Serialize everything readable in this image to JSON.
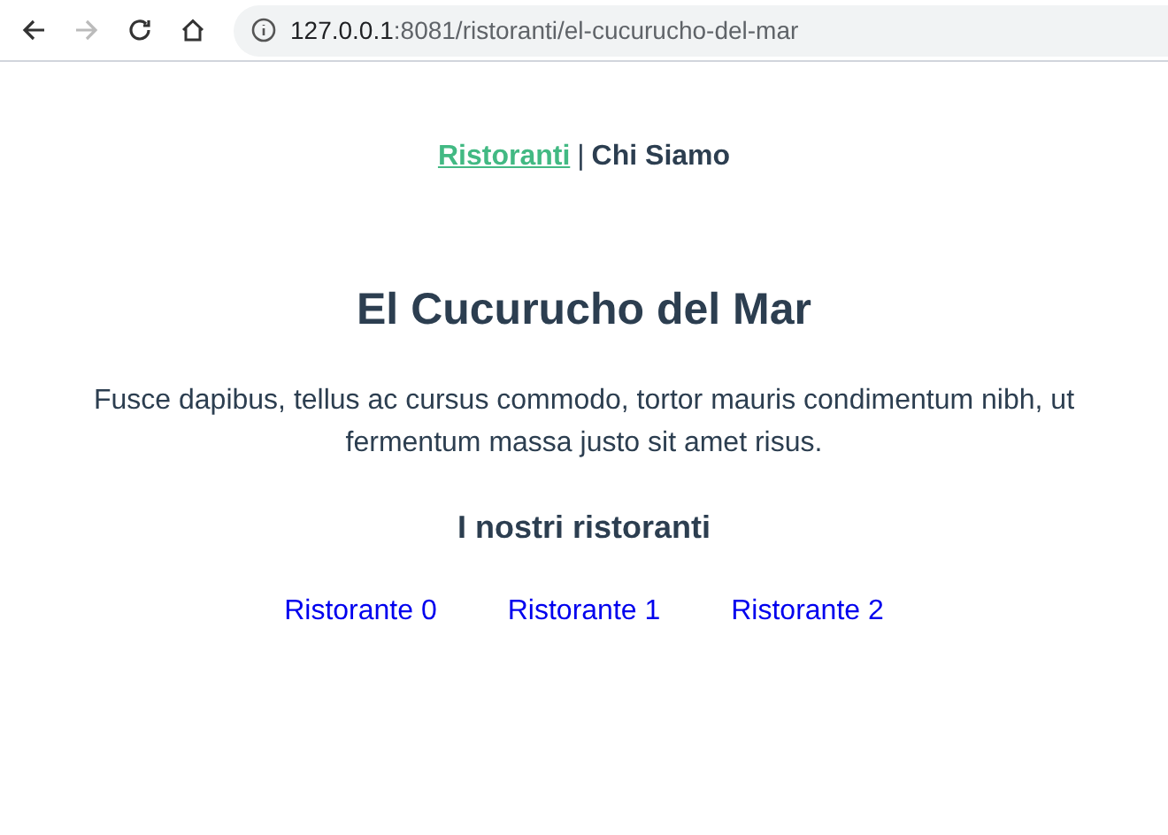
{
  "browser": {
    "back_enabled": true,
    "forward_enabled": false,
    "url_host": "127.0.0.1",
    "url_rest": ":8081/ristoranti/el-cucurucho-del-mar"
  },
  "nav": {
    "links": [
      {
        "label": "Ristoranti",
        "selected": true
      },
      {
        "label": "Chi Siamo",
        "selected": false
      }
    ],
    "separator": "|"
  },
  "title": "El Cucurucho del Mar",
  "description": "Fusce dapibus, tellus ac cursus commodo, tortor mauris condimentum nibh, ut fermentum massa justo sit amet risus.",
  "section_heading": "I nostri ristoranti",
  "restaurants": [
    "Ristorante 0",
    "Ristorante 1",
    "Ristorante 2"
  ]
}
